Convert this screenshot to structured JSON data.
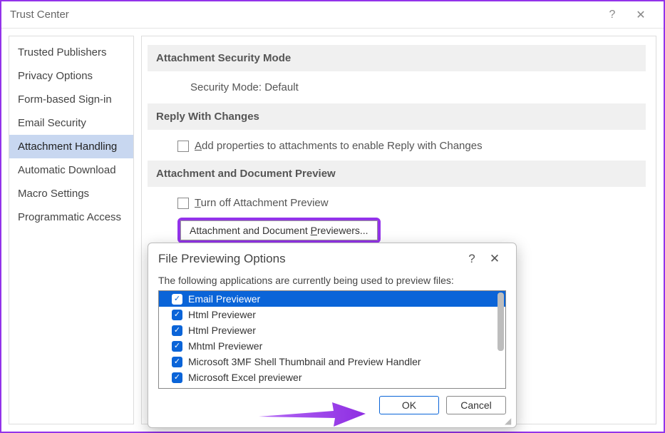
{
  "window": {
    "title": "Trust Center"
  },
  "sidebar": {
    "items": [
      {
        "label": "Trusted Publishers",
        "selected": false
      },
      {
        "label": "Privacy Options",
        "selected": false
      },
      {
        "label": "Form-based Sign-in",
        "selected": false
      },
      {
        "label": "Email Security",
        "selected": false
      },
      {
        "label": "Attachment Handling",
        "selected": true
      },
      {
        "label": "Automatic Download",
        "selected": false
      },
      {
        "label": "Macro Settings",
        "selected": false
      },
      {
        "label": "Programmatic Access",
        "selected": false
      }
    ]
  },
  "sections": {
    "security_mode": {
      "header": "Attachment Security Mode",
      "value_label": "Security Mode: Default"
    },
    "reply_changes": {
      "header": "Reply With Changes",
      "checkbox_mnemonic": "A",
      "checkbox_label_rest": "dd properties to attachments to enable Reply with Changes"
    },
    "preview": {
      "header": "Attachment and Document Preview",
      "turnoff_mnemonic": "T",
      "turnoff_rest": "urn off Attachment Preview",
      "button_prefix": "Attachment and Document ",
      "button_mnemonic": "P",
      "button_suffix": "reviewers..."
    }
  },
  "modal": {
    "title": "File Previewing Options",
    "description": "The following applications are currently being used to preview files:",
    "items": [
      {
        "label": "Email Previewer",
        "checked": true,
        "selected": true
      },
      {
        "label": "Html Previewer",
        "checked": true,
        "selected": false
      },
      {
        "label": "Html Previewer",
        "checked": true,
        "selected": false
      },
      {
        "label": "Mhtml Previewer",
        "checked": true,
        "selected": false
      },
      {
        "label": "Microsoft 3MF Shell Thumbnail and Preview Handler",
        "checked": true,
        "selected": false
      },
      {
        "label": "Microsoft Excel previewer",
        "checked": true,
        "selected": false
      }
    ],
    "ok": "OK",
    "cancel": "Cancel"
  }
}
